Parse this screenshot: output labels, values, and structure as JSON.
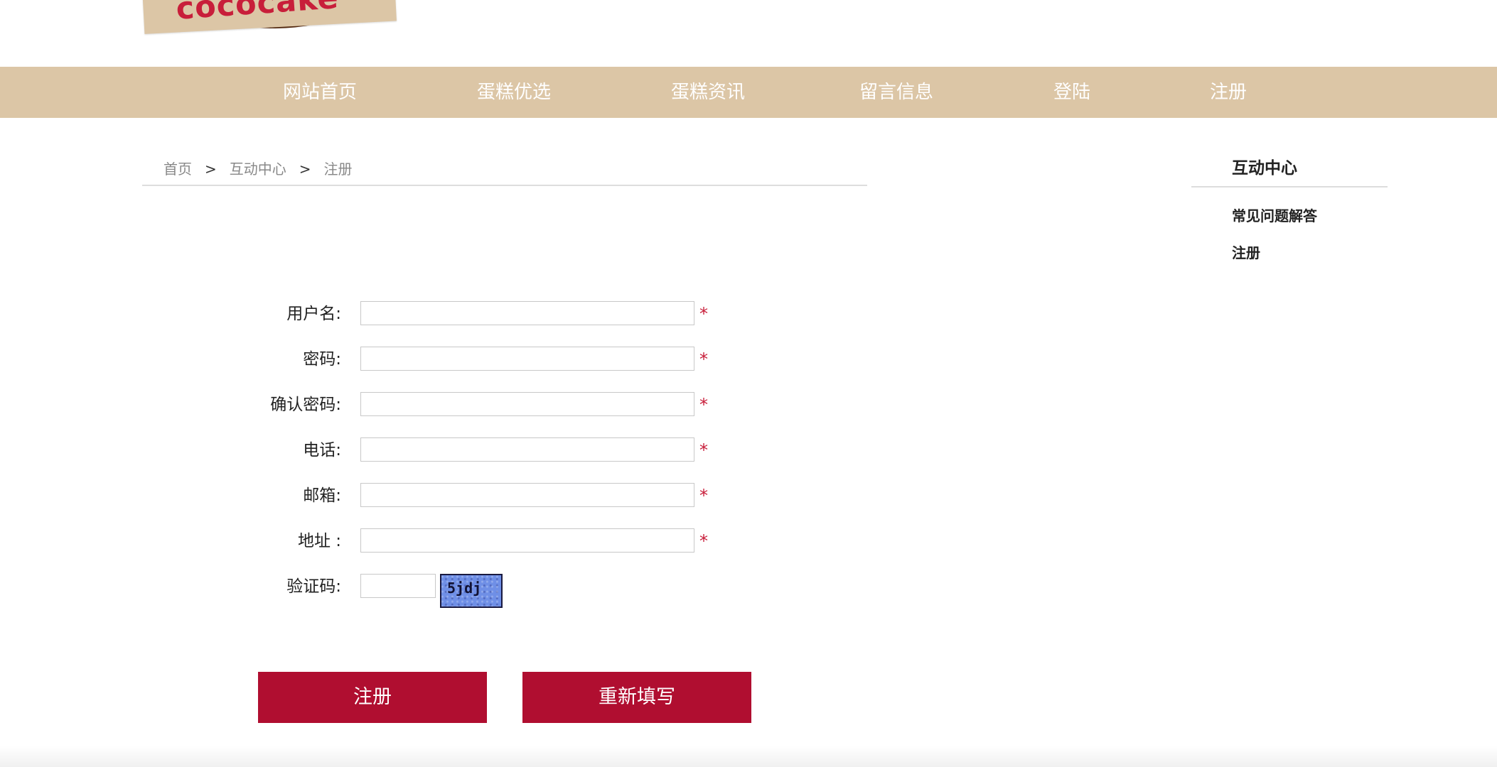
{
  "logo": {
    "text": "cococake"
  },
  "nav": {
    "items": [
      "网站首页",
      "蛋糕优选",
      "蛋糕资讯",
      "留言信息",
      "登陆",
      "注册"
    ]
  },
  "breadcrumb": {
    "home": "首页",
    "separator": ">",
    "section": "互动中心",
    "current": "注册"
  },
  "sidebar": {
    "title": "互动中心",
    "items": [
      "常见问题解答",
      "注册"
    ]
  },
  "form": {
    "fields": [
      {
        "label": "用户名:",
        "value": "",
        "required_mark": "*"
      },
      {
        "label": "密码:",
        "value": "",
        "required_mark": "*"
      },
      {
        "label": "确认密码:",
        "value": "",
        "required_mark": "*"
      },
      {
        "label": "电话:",
        "value": "",
        "required_mark": "*"
      },
      {
        "label": "邮箱:",
        "value": "",
        "required_mark": "*"
      },
      {
        "label": "地址 :",
        "value": "",
        "required_mark": "*"
      }
    ],
    "captcha": {
      "label": "验证码:",
      "value": "",
      "image_text": "5jdj"
    }
  },
  "buttons": {
    "submit": "注册",
    "reset": "重新填写"
  },
  "colors": {
    "nav_bg": "#dcc6a6",
    "button_bg": "#b00e30",
    "required": "#c81e3a",
    "logo_text": "#c81e3a",
    "logo_ring": "#5a2d12",
    "captcha_bg": "#6f8fe6"
  }
}
